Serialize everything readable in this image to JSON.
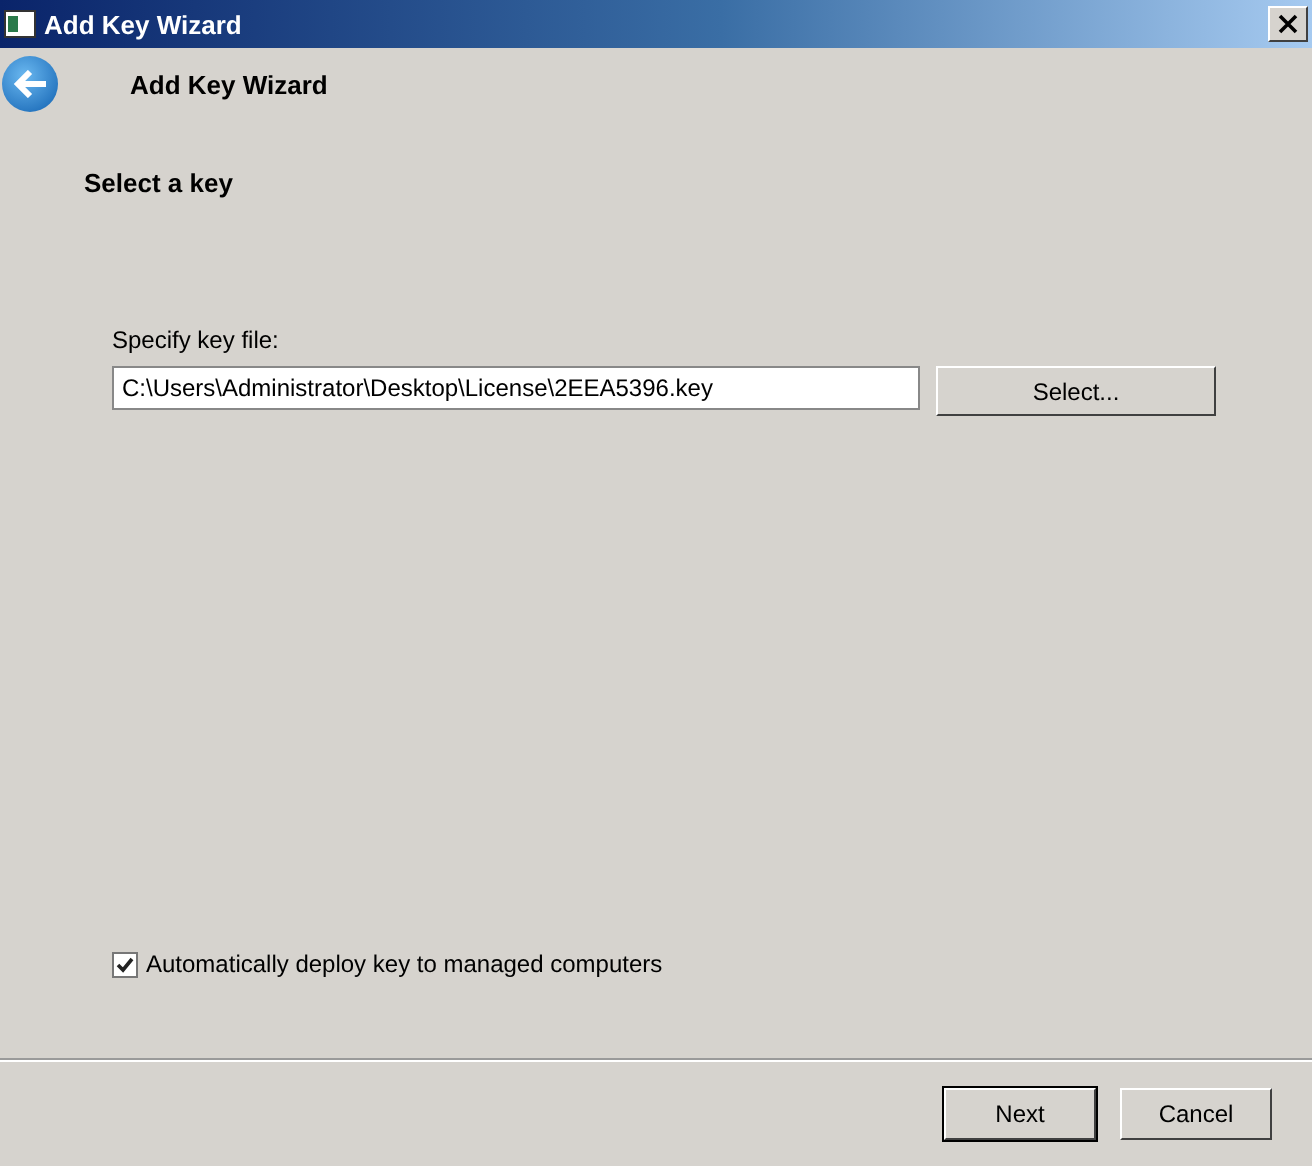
{
  "window": {
    "title": "Add Key Wizard"
  },
  "header": {
    "title": "Add Key Wizard"
  },
  "page": {
    "heading": "Select a key",
    "key_file": {
      "label": "Specify key file:",
      "value": "C:\\Users\\Administrator\\Desktop\\License\\2EEA5396.key",
      "button": "Select..."
    },
    "auto_deploy": {
      "label": "Automatically deploy key to managed computers",
      "checked": true
    }
  },
  "buttons": [
    {
      "label": "Next",
      "kind": "default"
    },
    {
      "label": "Cancel",
      "kind": "normal"
    }
  ]
}
